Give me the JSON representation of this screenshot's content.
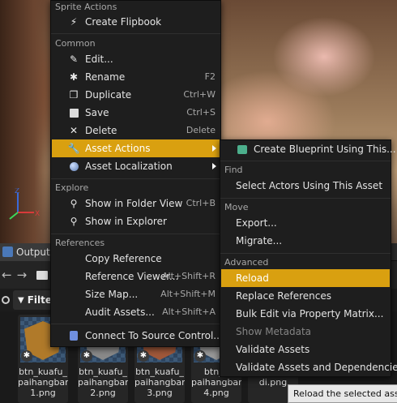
{
  "output_tab": {
    "label": "Output"
  },
  "filter": {
    "label": "Filte"
  },
  "assets": [
    {
      "line1": "btn_kuafu_",
      "line2": "paihangbang",
      "line3": "1.png",
      "color": "#b07a2a"
    },
    {
      "line1": "btn_kuafu_",
      "line2": "paihangbang",
      "line3": "2.png",
      "color": "#8a8a8a"
    },
    {
      "line1": "btn_kuafu_",
      "line2": "paihangbang",
      "line3": "3.png",
      "color": "#a0583a"
    },
    {
      "line1": "btn_k",
      "line2": "paihangbang",
      "line3": "4.png",
      "color": "#9a9a9a"
    },
    {
      "line1": "",
      "line2": "paihangbang",
      "line3": "di.png",
      "color": "#6a5a4a"
    }
  ],
  "main_menu": {
    "sprite_actions_header": "Sprite Actions",
    "create_flipbook": "Create Flipbook",
    "common_header": "Common",
    "edit": "Edit...",
    "rename": "Rename",
    "rename_shortcut": "F2",
    "duplicate": "Duplicate",
    "duplicate_shortcut": "Ctrl+W",
    "save": "Save",
    "save_shortcut": "Ctrl+S",
    "delete": "Delete",
    "delete_shortcut": "Delete",
    "asset_actions": "Asset Actions",
    "asset_localization": "Asset Localization",
    "explore_header": "Explore",
    "show_in_folder_view": "Show in Folder View",
    "show_in_folder_view_shortcut": "Ctrl+B",
    "show_in_explorer": "Show in Explorer",
    "references_header": "References",
    "copy_reference": "Copy Reference",
    "reference_viewer": "Reference Viewer...",
    "reference_viewer_shortcut": "Alt+Shift+R",
    "size_map": "Size Map...",
    "size_map_shortcut": "Alt+Shift+M",
    "audit_assets": "Audit Assets...",
    "audit_assets_shortcut": "Alt+Shift+A",
    "connect_source_control": "Connect To Source Control..."
  },
  "sub_menu": {
    "create_blueprint": "Create Blueprint Using This...",
    "find_header": "Find",
    "select_actors": "Select Actors Using This Asset",
    "move_header": "Move",
    "export": "Export...",
    "migrate": "Migrate...",
    "advanced_header": "Advanced",
    "reload": "Reload",
    "replace_references": "Replace References",
    "bulk_edit": "Bulk Edit via Property Matrix...",
    "show_metadata": "Show Metadata",
    "validate_assets": "Validate Assets",
    "validate_assets_deps": "Validate Assets and Dependencies"
  },
  "tooltip": {
    "text": "Reload the selected asset"
  },
  "colors": {
    "highlight": "#d9a010",
    "menu_bg": "#1e1e1e"
  }
}
